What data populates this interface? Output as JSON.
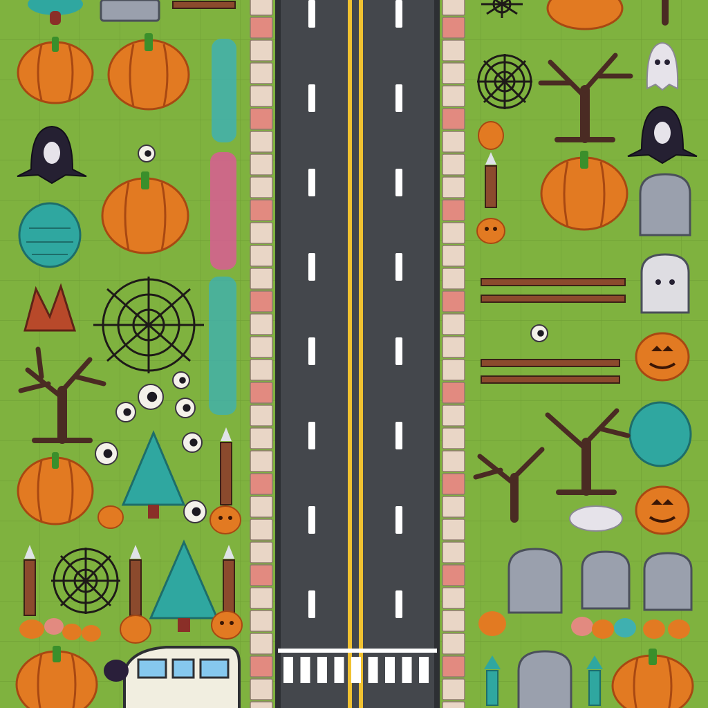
{
  "scene": {
    "name": "halloween-road-tileset",
    "colors": {
      "grass": "#7fb23f",
      "grass_grid": "#6fa035",
      "asphalt": "#44474c",
      "asphalt_edge": "#2d2f33",
      "lane_dash": "#ffffff",
      "center_line": "#f1c231",
      "curb_light": "#e9d6c6",
      "curb_pink": "#e28a80",
      "pumpkin": "#e27a22",
      "pumpkin_dark": "#a84812",
      "stem": "#3a8f2b",
      "ghost_dark": "#252032",
      "ghost_light": "#e6e3ea",
      "tree_teal": "#2fa7a0",
      "dead_tree": "#4a2b23",
      "fence_wood": "#8b4a2d",
      "tombstone": "#9aa0ad",
      "web": "#1e1a18",
      "van_body": "#f1eee0",
      "van_window": "#86c8ee"
    },
    "road": {
      "lanes": 2,
      "center_line": "double-yellow",
      "crosswalk": true,
      "dashes_per_lane": 8
    },
    "sprites": {
      "pumpkins": 9,
      "jack_o_lanterns": 7,
      "ghosts": 3,
      "spider_webs": 4,
      "bare_trees": 4,
      "teal_trees": 4,
      "fences": 2,
      "tombstones": 7,
      "lamp_posts": 6,
      "eyeballs": 9,
      "vehicles": 1
    }
  }
}
